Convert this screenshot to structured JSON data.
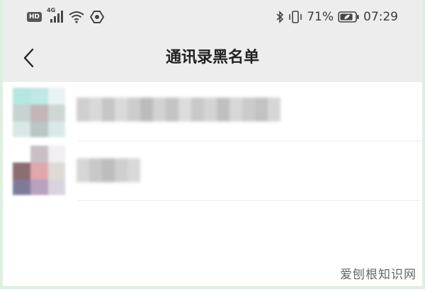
{
  "status_bar": {
    "hd_badge": "HD",
    "network_type": "4G",
    "battery_percent": "71%",
    "time": "07:29",
    "icons": [
      "signal-icon",
      "wifi-icon",
      "shield-icon",
      "bluetooth-icon",
      "vibrate-icon",
      "battery-icon"
    ]
  },
  "header": {
    "title": "通讯录黑名单",
    "back_icon": "chevron-left-icon"
  },
  "blocked_contacts": [
    {
      "avatar_colors": [
        "#b6e6e2",
        "#bfe9e5",
        "#e8f3f2",
        "#c6d3d0",
        "#c4b6b8",
        "#cfd6d4",
        "#d9e8e6",
        "#b8c6c4",
        "#d9e9e9"
      ]
    },
    {
      "avatar_colors": [
        "#ffffff",
        "#c9bfc4",
        "#f1eff1",
        "#8b6d72",
        "#e0a8ad",
        "#dedad7",
        "#7f7a98",
        "#b8a2bd",
        "#d9d4e0"
      ]
    }
  ],
  "watermark": "爱刨根知识网",
  "colors": {
    "bar": "#ededed",
    "list_bg": "#ffffff",
    "frame": "#dfeee0"
  }
}
